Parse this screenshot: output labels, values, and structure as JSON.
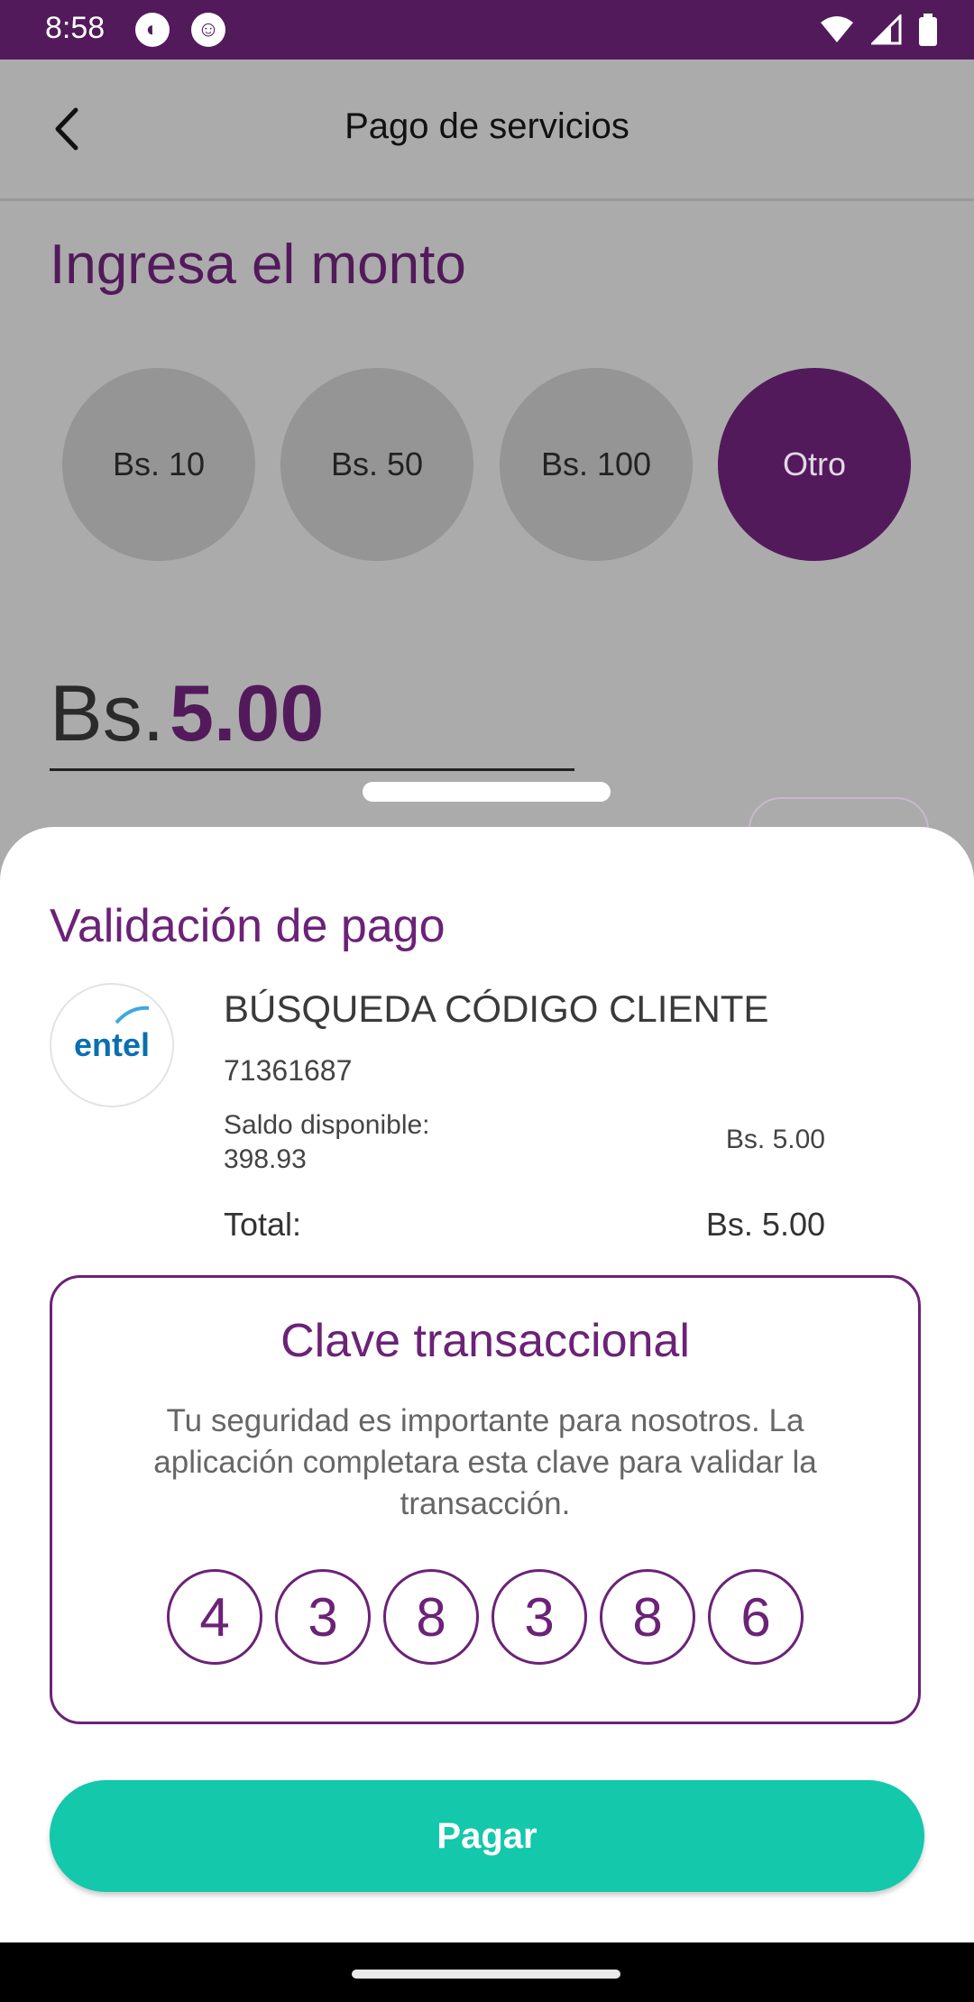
{
  "status_bar": {
    "time": "8:58"
  },
  "app_bar": {
    "title": "Pago de servicios"
  },
  "amount_section": {
    "title": "Ingresa el monto",
    "options": [
      "Bs. 10",
      "Bs. 50",
      "Bs. 100",
      "Otro"
    ],
    "selected": "Otro",
    "currency_prefix": "Bs.",
    "value": "5.00"
  },
  "sheet": {
    "title": "Validación de pago",
    "logo_text": "entel",
    "service_name": "BÚSQUEDA CÓDIGO CLIENTE",
    "client_code": "71361687",
    "balance_label": "Saldo disponible:",
    "balance_value": "398.93",
    "amount": "Bs. 5.00",
    "total_label": "Total:",
    "total_value": "Bs. 5.00",
    "pin": {
      "title": "Clave transaccional",
      "description": "Tu seguridad es importante para nosotros. La aplicación completara esta clave para validar la transacción.",
      "digits": [
        "4",
        "3",
        "8",
        "3",
        "8",
        "6"
      ]
    },
    "pay_label": "Pagar"
  },
  "colors": {
    "brand_purple": "#521a5b",
    "accent_teal": "#13c8ab"
  }
}
